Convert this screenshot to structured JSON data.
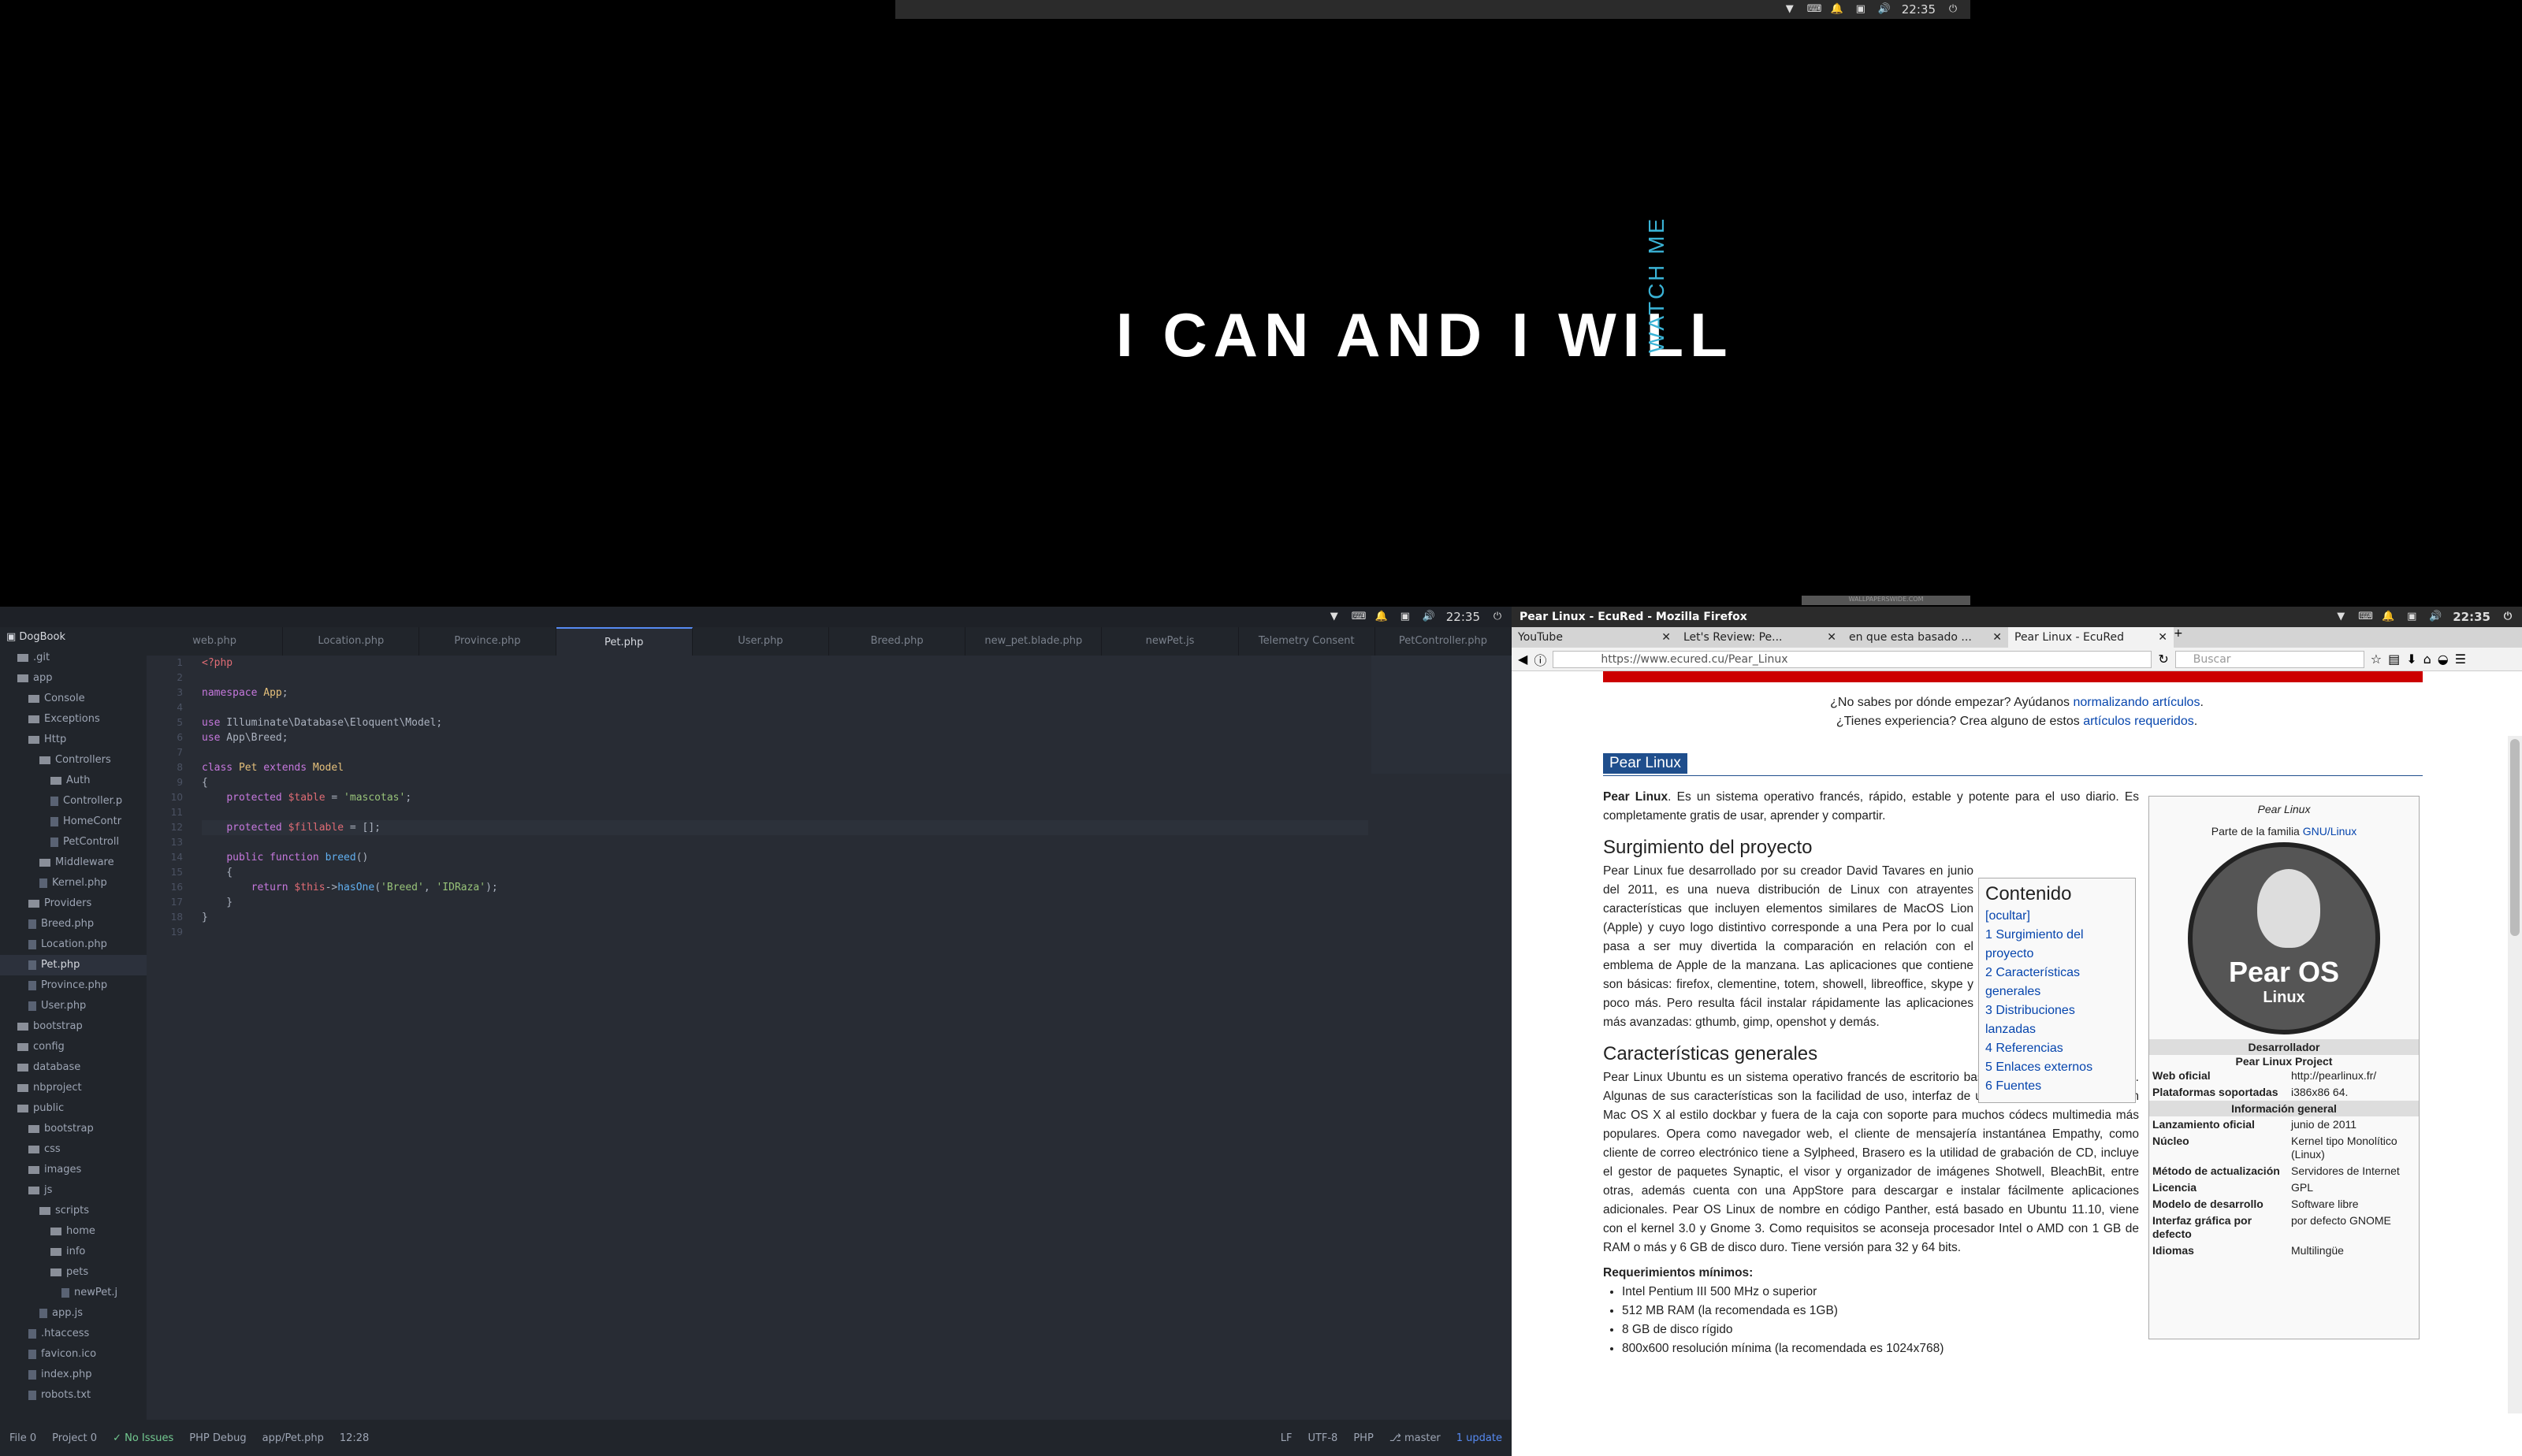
{
  "top_tray": {
    "time": "22:35"
  },
  "wallpaper": {
    "slogan": "I CAN AND I WILL",
    "side_text": "WATCH ME",
    "watermark": "WALLPAPERSWIDE.COM"
  },
  "editor": {
    "tray_time": "22:35",
    "project": "DogBook",
    "tree": [
      {
        "name": ".git",
        "indent": 1,
        "type": "folder"
      },
      {
        "name": "app",
        "indent": 1,
        "type": "folder"
      },
      {
        "name": "Console",
        "indent": 2,
        "type": "folder"
      },
      {
        "name": "Exceptions",
        "indent": 2,
        "type": "folder"
      },
      {
        "name": "Http",
        "indent": 2,
        "type": "folder"
      },
      {
        "name": "Controllers",
        "indent": 3,
        "type": "folder"
      },
      {
        "name": "Auth",
        "indent": 4,
        "type": "folder"
      },
      {
        "name": "Controller.p",
        "indent": 4,
        "type": "file"
      },
      {
        "name": "HomeContr",
        "indent": 4,
        "type": "file"
      },
      {
        "name": "PetControll",
        "indent": 4,
        "type": "file"
      },
      {
        "name": "Middleware",
        "indent": 3,
        "type": "folder"
      },
      {
        "name": "Kernel.php",
        "indent": 3,
        "type": "file"
      },
      {
        "name": "Providers",
        "indent": 2,
        "type": "folder"
      },
      {
        "name": "Breed.php",
        "indent": 2,
        "type": "file"
      },
      {
        "name": "Location.php",
        "indent": 2,
        "type": "file"
      },
      {
        "name": "Pet.php",
        "indent": 2,
        "type": "file",
        "selected": true
      },
      {
        "name": "Province.php",
        "indent": 2,
        "type": "file"
      },
      {
        "name": "User.php",
        "indent": 2,
        "type": "file"
      },
      {
        "name": "bootstrap",
        "indent": 1,
        "type": "folder"
      },
      {
        "name": "config",
        "indent": 1,
        "type": "folder"
      },
      {
        "name": "database",
        "indent": 1,
        "type": "folder"
      },
      {
        "name": "nbproject",
        "indent": 1,
        "type": "folder"
      },
      {
        "name": "public",
        "indent": 1,
        "type": "folder"
      },
      {
        "name": "bootstrap",
        "indent": 2,
        "type": "folder"
      },
      {
        "name": "css",
        "indent": 2,
        "type": "folder"
      },
      {
        "name": "images",
        "indent": 2,
        "type": "folder"
      },
      {
        "name": "js",
        "indent": 2,
        "type": "folder"
      },
      {
        "name": "scripts",
        "indent": 3,
        "type": "folder"
      },
      {
        "name": "home",
        "indent": 4,
        "type": "folder"
      },
      {
        "name": "info",
        "indent": 4,
        "type": "folder"
      },
      {
        "name": "pets",
        "indent": 4,
        "type": "folder"
      },
      {
        "name": "newPet.j",
        "indent": 5,
        "type": "file"
      },
      {
        "name": "app.js",
        "indent": 3,
        "type": "file"
      },
      {
        "name": ".htaccess",
        "indent": 2,
        "type": "file"
      },
      {
        "name": "favicon.ico",
        "indent": 2,
        "type": "file"
      },
      {
        "name": "index.php",
        "indent": 2,
        "type": "file"
      },
      {
        "name": "robots.txt",
        "indent": 2,
        "type": "file"
      }
    ],
    "tabs": [
      "web.php",
      "Location.php",
      "Province.php",
      "Pet.php",
      "User.php",
      "Breed.php",
      "new_pet.blade.php",
      "newPet.js",
      "Telemetry Consent",
      "PetController.php"
    ],
    "active_tab": 3,
    "line_numbers": [
      "1",
      "2",
      "3",
      "4",
      "5",
      "6",
      "7",
      "8",
      "9",
      "10",
      "11",
      "12",
      "13",
      "14",
      "15",
      "16",
      "17",
      "18",
      "19"
    ],
    "status": {
      "file": "File 0",
      "project": "Project 0",
      "issues": "No Issues",
      "debug": "PHP Debug",
      "path": "app/Pet.php",
      "cursor": "12:28",
      "eol": "LF",
      "encoding": "UTF-8",
      "grammar": "PHP",
      "branch": "master",
      "update": "1 update"
    }
  },
  "firefox": {
    "window_title": "Pear Linux - EcuRed - Mozilla Firefox",
    "tray_time": "22:35",
    "tabs": [
      "YouTube",
      "Let's Review: Pe...",
      "en que esta basado ...",
      "Pear Linux - EcuRed"
    ],
    "active_tab": 3,
    "url": "https://www.ecured.cu/Pear_Linux",
    "search_placeholder": "Buscar",
    "help1_pre": "¿No sabes por dónde empezar? Ayúdanos ",
    "help1_link": "normalizando artículos",
    "help1_post": ".",
    "help2_pre": "¿Tienes experiencia? Crea alguno de estos ",
    "help2_link": "artículos requeridos",
    "help2_post": ".",
    "title": "Pear Linux",
    "intro_bold": "Pear Linux",
    "intro": ". Es un sistema operativo francés, rápido, estable y potente para el uso diario. Es completamente gratis de usar, aprender y compartir.",
    "h2_1": "Surgimiento del proyecto",
    "p1": "Pear Linux fue desarrollado por su creador David Tavares en junio del 2011, es una nueva distribución de Linux con atrayentes características que incluyen elementos similares de MacOS Lion (Apple) y cuyo logo distintivo corresponde a una Pera por lo cual pasa a ser muy divertida la comparación en relación con el emblema de Apple de la manzana. Las aplicaciones que contiene son básicas: firefox, clementine, totem, showell, libreoffice, skype y poco más. Pero resulta fácil instalar rápidamente las aplicaciones más avanzadas: gthumb, gimp, openshot y demás.",
    "h2_2": "Características generales",
    "p2": "Pear Linux Ubuntu es un sistema operativo francés de escritorio basado en la distribución Linux. Algunas de sus características son la facilidad de uso, interfaz de usuario personalizada con un Mac OS X al estilo dockbar y fuera de la caja con soporte para muchos códecs multimedia más populares. Opera como navegador web, el cliente de mensajería instantánea Empathy, como cliente de correo electrónico tiene a Sylpheed, Brasero es la utilidad de grabación de CD, incluye el gestor de paquetes Synaptic, el visor y organizador de imágenes Shotwell, BleachBit, entre otras, además cuenta con una AppStore para descargar e instalar fácilmente aplicaciones adicionales. Pear OS Linux de nombre en código Panther, está basado en Ubuntu 11.10, viene con el kernel 3.0 y Gnome 3. Como requisitos se aconseja procesador Intel o AMD con 1 GB de RAM o más y 6 GB de disco duro. Tiene versión para 32 y 64 bits.",
    "req_title": "Requerimientos mínimos:",
    "reqs": [
      "Intel Pentium III 500 MHz o superior",
      "512 MB RAM (la recomendada es 1GB)",
      "8 GB de disco rígido",
      "800x600 resolución mínima (la recomendada es 1024x768)"
    ],
    "toc": {
      "title": "Contenido",
      "hide": "[ocultar]",
      "items": [
        "1 Surgimiento del proyecto",
        "2 Características generales",
        "3 Distribuciones lanzadas",
        "4 Referencias",
        "5 Enlaces externos",
        "6 Fuentes"
      ]
    },
    "infobox": {
      "name": "Pear Linux",
      "family_pre": "Parte de la familia ",
      "family_link": "GNU/Linux",
      "logo_text": "Pear OS",
      "logo_sub": "Linux",
      "dev_head": "Desarrollador",
      "dev": "Pear Linux Project",
      "rows": [
        [
          "Web oficial",
          "http://pearlinux.fr/"
        ],
        [
          "Plataformas soportadas",
          "i386x86 64."
        ]
      ],
      "gen_head": "Información general",
      "rows2": [
        [
          "Lanzamiento oficial",
          "junio de 2011"
        ],
        [
          "Núcleo",
          "Kernel tipo Monolítico (Linux)"
        ],
        [
          "Método de actualización",
          "Servidores de Internet"
        ],
        [
          "Licencia",
          "GPL"
        ],
        [
          "Modelo de desarrollo",
          "Software libre"
        ],
        [
          "Interfaz gráfica por defecto",
          "por defecto GNOME"
        ],
        [
          "Idiomas",
          "Multilingüe"
        ]
      ]
    }
  }
}
